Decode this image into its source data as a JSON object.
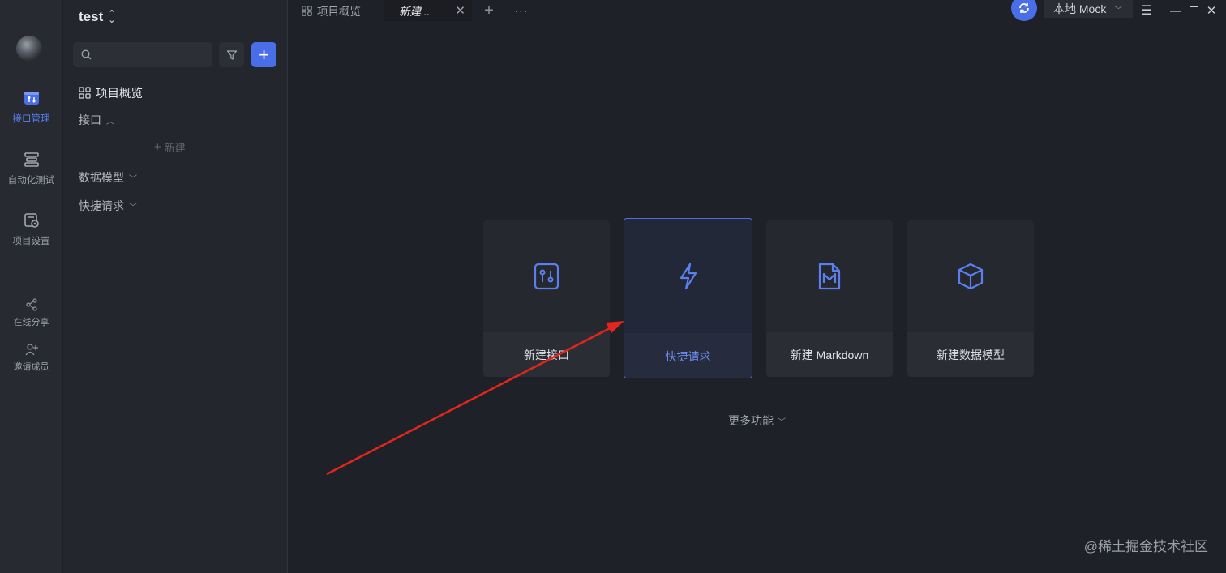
{
  "rail": {
    "items": [
      {
        "label": "接口管理",
        "icon": "api-management-icon",
        "active": true
      },
      {
        "label": "自动化测试",
        "icon": "automation-test-icon"
      },
      {
        "label": "项目设置",
        "icon": "project-settings-icon"
      },
      {
        "label": "在线分享",
        "icon": "share-icon"
      },
      {
        "label": "邀请成员",
        "icon": "invite-member-icon"
      }
    ]
  },
  "sidebar": {
    "project_name": "test",
    "search_placeholder": "",
    "tree": [
      {
        "label": "项目概览",
        "icon": "grid-icon"
      },
      {
        "label": "接口",
        "chevron": "up"
      },
      {
        "label": "数据模型",
        "chevron": "down"
      },
      {
        "label": "快捷请求",
        "chevron": "down"
      }
    ],
    "new_label": "新建"
  },
  "tabs": [
    {
      "label": "项目概览",
      "icon": "grid-icon"
    },
    {
      "label": "新建...",
      "active": true
    }
  ],
  "header": {
    "mock_env": "本地 Mock"
  },
  "main": {
    "cards": [
      {
        "label": "新建接口",
        "icon": "api-doc-icon"
      },
      {
        "label": "快捷请求",
        "icon": "lightning-icon",
        "selected": true
      },
      {
        "label": "新建 Markdown",
        "icon": "markdown-icon"
      },
      {
        "label": "新建数据模型",
        "icon": "cube-icon"
      }
    ],
    "more_label": "更多功能"
  },
  "watermark": "@稀土掘金技术社区",
  "colors": {
    "accent": "#4a6ee8",
    "background": "#1f2128",
    "annotation_arrow": "#e3261d"
  }
}
